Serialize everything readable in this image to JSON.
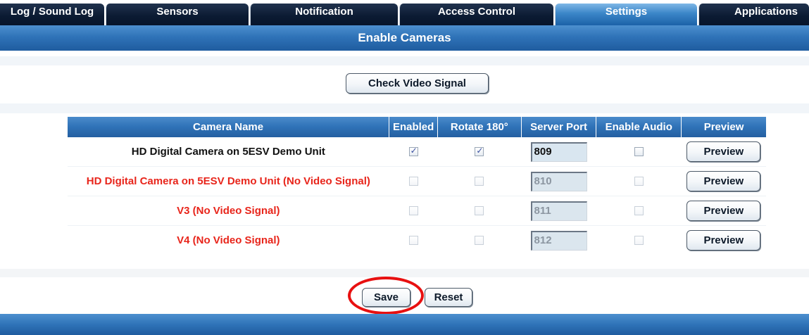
{
  "tabs": [
    {
      "label": "Log / Sound Log",
      "active": false
    },
    {
      "label": "Sensors",
      "active": false
    },
    {
      "label": "Notification",
      "active": false
    },
    {
      "label": "Access Control",
      "active": false
    },
    {
      "label": "Settings",
      "active": true
    },
    {
      "label": "Applications",
      "active": false
    }
  ],
  "section": {
    "title": "Enable Cameras"
  },
  "check_signal_button": "Check Video Signal",
  "table": {
    "headers": {
      "camera_name": "Camera Name",
      "enabled": "Enabled",
      "rotate": "Rotate 180°",
      "server_port": "Server Port",
      "enable_audio": "Enable Audio",
      "preview": "Preview"
    },
    "rows": [
      {
        "name": "HD Digital Camera on 5ESV Demo Unit",
        "enabled": true,
        "rotate": true,
        "port": "809",
        "audio": false,
        "preview": "Preview",
        "no_signal": false
      },
      {
        "name": "HD Digital Camera on 5ESV Demo Unit (No Video Signal)",
        "enabled": false,
        "rotate": false,
        "port": "810",
        "audio": false,
        "preview": "Preview",
        "no_signal": true
      },
      {
        "name": "V3 (No Video Signal)",
        "enabled": false,
        "rotate": false,
        "port": "811",
        "audio": false,
        "preview": "Preview",
        "no_signal": true
      },
      {
        "name": "V4 (No Video Signal)",
        "enabled": false,
        "rotate": false,
        "port": "812",
        "audio": false,
        "preview": "Preview",
        "no_signal": true
      }
    ]
  },
  "actions": {
    "save": "Save",
    "reset": "Reset"
  },
  "colors": {
    "tab_dark": "#0b1a32",
    "tab_active": "#3b86c8",
    "header_blue": "#2f73b8",
    "no_signal_red": "#e8251b",
    "highlight_red": "#e81010"
  }
}
